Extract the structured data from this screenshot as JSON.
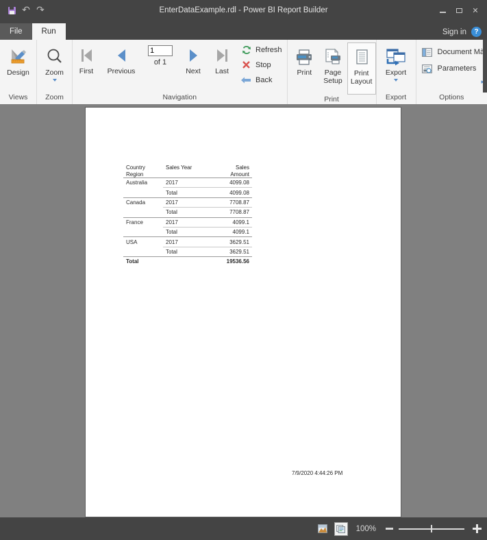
{
  "titlebar": {
    "title": "EnterDataExample.rdl - Power BI Report Builder",
    "quick_access": [
      {
        "name": "save-icon",
        "label": "Save"
      },
      {
        "name": "undo-icon",
        "label": "↶"
      },
      {
        "name": "redo-icon",
        "label": "↷"
      }
    ],
    "window_controls": {
      "minimize": "–",
      "restore": "❐",
      "close": "✕"
    }
  },
  "tabs": {
    "file": "File",
    "run": "Run",
    "signin": "Sign in",
    "help": "?"
  },
  "ribbon": {
    "groups": [
      {
        "label": "Views"
      },
      {
        "label": "Zoom"
      },
      {
        "label": "Navigation"
      },
      {
        "label": "Print"
      },
      {
        "label": "Export"
      },
      {
        "label": "Options"
      }
    ],
    "views": {
      "design": "Design"
    },
    "zoom": {
      "zoom": "Zoom"
    },
    "navigation": {
      "first": "First",
      "previous": "Previous",
      "next": "Next",
      "last": "Last",
      "page_value": "1",
      "of_label": "of  1",
      "refresh": "Refresh",
      "stop": "Stop",
      "back": "Back"
    },
    "print": {
      "print": "Print",
      "page_setup": "Page\nSetup",
      "page_setup_line1": "Page",
      "page_setup_line2": "Setup",
      "print_layout_line1": "Print",
      "print_layout_line2": "Layout"
    },
    "export": {
      "export": "Export"
    },
    "options": {
      "document_map": "Document Mà",
      "parameters": "Parameters",
      "more": "▸"
    }
  },
  "report": {
    "table": {
      "headers": [
        "Country\nRegion",
        "Sales Year",
        "Sales\nAmount"
      ],
      "header_country_line1": "Country",
      "header_country_line2": "Region",
      "header_year": "Sales Year",
      "header_amount_line1": "Sales",
      "header_amount_line2": "Amount",
      "rows": [
        {
          "country": "Australia",
          "year": "2017",
          "amount": "4099.08"
        },
        {
          "country": "",
          "year": "Total",
          "amount": "4099.08"
        },
        {
          "country": "Canada",
          "year": "2017",
          "amount": "7708.87"
        },
        {
          "country": "",
          "year": "Total",
          "amount": "7708.87"
        },
        {
          "country": "France",
          "year": "2017",
          "amount": "4099.1"
        },
        {
          "country": "",
          "year": "Total",
          "amount": "4099.1"
        },
        {
          "country": "USA",
          "year": "2017",
          "amount": "3629.51"
        },
        {
          "country": "",
          "year": "Total",
          "amount": "3629.51"
        }
      ],
      "grand_total": {
        "label": "Total",
        "amount": "19536.56"
      }
    },
    "timestamp": "7/9/2020 4:44:26 PM"
  },
  "statusbar": {
    "zoom_level": "100%",
    "view_normal": "normal-view",
    "view_print_layout": "print-layout-view"
  },
  "colors": {
    "chrome": "#444444",
    "ribbon": "#f4f4f4",
    "workspace": "#808080",
    "accent_blue": "#5b8fc9",
    "save_purple": "#a97fd6",
    "refresh_green": "#3f9b5b",
    "stop_red": "#d9534f"
  }
}
